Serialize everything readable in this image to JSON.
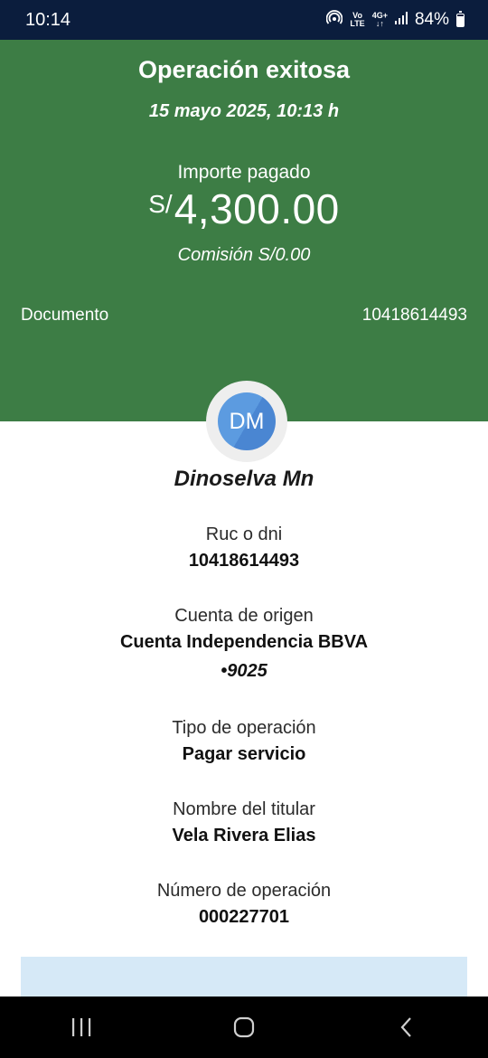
{
  "status_bar": {
    "time": "10:14",
    "volte": "Vo\nLTE",
    "network": "4G+",
    "battery": "84%"
  },
  "receipt": {
    "title": "Operación exitosa",
    "datetime": "15 mayo 2025, 10:13 h",
    "amount_label": "Importe pagado",
    "currency": "S/",
    "amount": "4,300.00",
    "commission": "Comisión  S/0.00",
    "document_label": "Documento",
    "document_value": "10418614493"
  },
  "payee": {
    "initials": "DM",
    "name": "Dinoselva Mn"
  },
  "details": {
    "ruc_label": "Ruc o dni",
    "ruc_value": "10418614493",
    "account_label": "Cuenta de origen",
    "account_name": "Cuenta Independencia BBVA",
    "account_number": "•9025",
    "operation_type_label": "Tipo de operación",
    "operation_type_value": "Pagar servicio",
    "holder_label": "Nombre del titular",
    "holder_value": "Vela Rivera Elias",
    "operation_number_label": "Número de operación",
    "operation_number_value": "000227701"
  },
  "colors": {
    "status_bar": "#0b1d3d",
    "success_green": "#3d7d45",
    "avatar_blue": "#5c9be0",
    "info_box": "#d6e9f7"
  },
  "icons": [
    "hotspot-icon",
    "volte-icon",
    "network-4g-icon",
    "signal-icon",
    "battery-icon",
    "recent-apps-icon",
    "home-icon",
    "back-icon"
  ]
}
